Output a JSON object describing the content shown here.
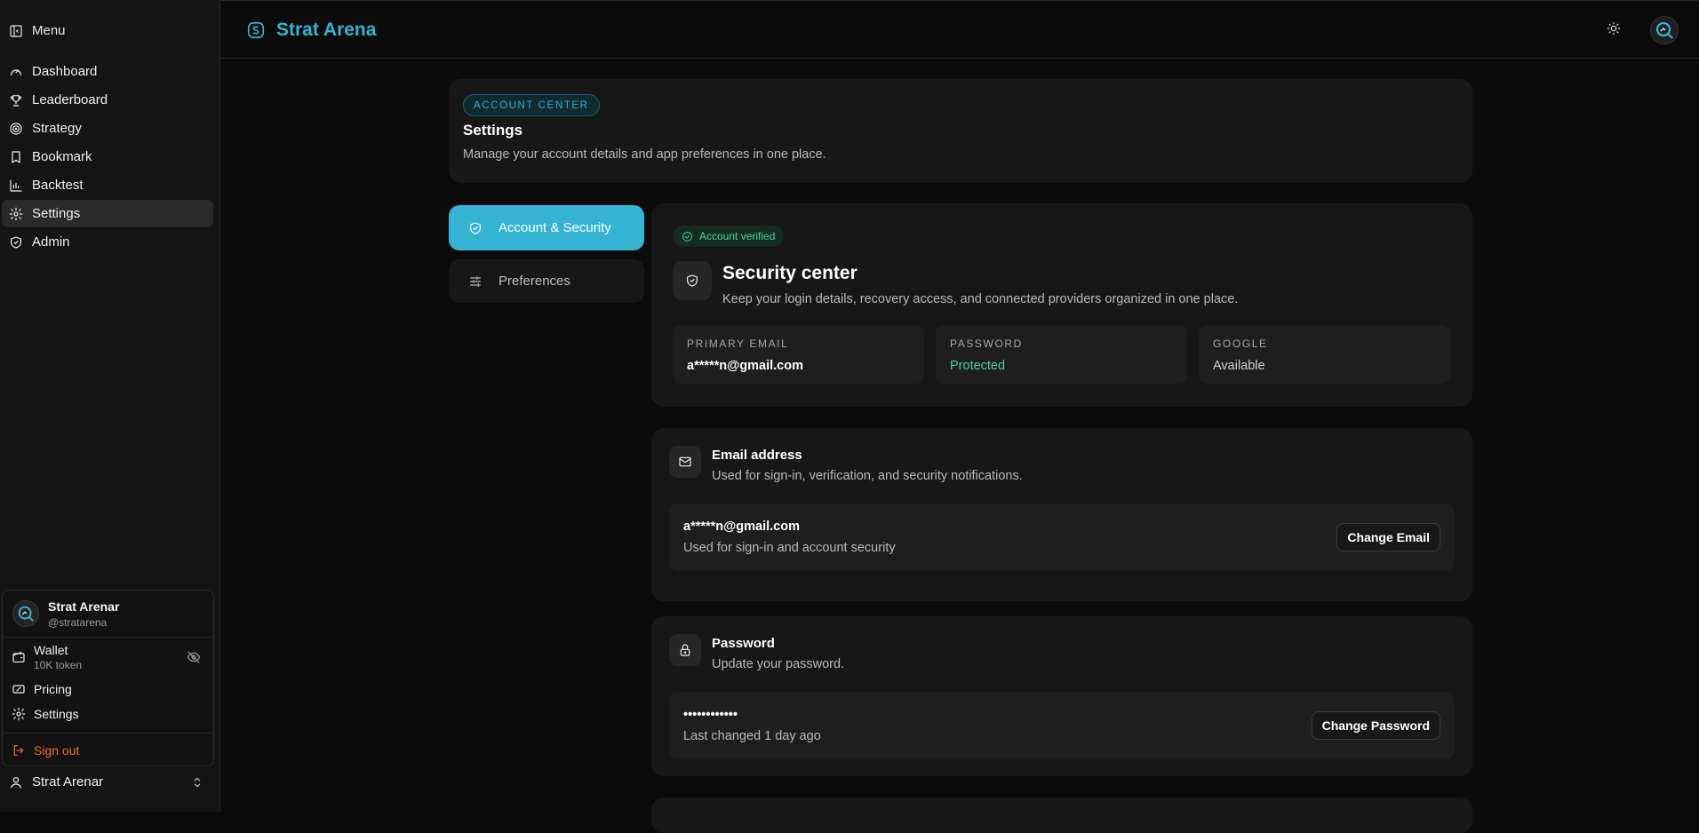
{
  "sidebar": {
    "menu_label": "Menu",
    "items": [
      {
        "label": "Dashboard",
        "icon": "gauge-icon"
      },
      {
        "label": "Leaderboard",
        "icon": "trophy-icon"
      },
      {
        "label": "Strategy",
        "icon": "target-icon"
      },
      {
        "label": "Bookmark",
        "icon": "bookmark-icon"
      },
      {
        "label": "Backtest",
        "icon": "chart-icon"
      },
      {
        "label": "Settings",
        "icon": "gear-icon",
        "active": true
      },
      {
        "label": "Admin",
        "icon": "shield-icon"
      }
    ],
    "user_card": {
      "name": "Strat Arenar",
      "handle": "@stratarena",
      "wallet_label": "Wallet",
      "wallet_sub": "10K token",
      "pricing_label": "Pricing",
      "settings_label": "Settings",
      "signout_label": "Sign out"
    },
    "footer_user": "Strat Arenar"
  },
  "topbar": {
    "brand": "Strat Arena"
  },
  "account_header": {
    "badge": "ACCOUNT CENTER",
    "title": "Settings",
    "description": "Manage your account details and app preferences in one place."
  },
  "tabs": [
    {
      "label": "Account & Security",
      "active": true
    },
    {
      "label": "Preferences",
      "active": false
    }
  ],
  "security": {
    "verified_label": "Account verified",
    "title": "Security center",
    "description": "Keep your login details, recovery access, and connected providers organized in one place.",
    "stats": [
      {
        "label": "PRIMARY EMAIL",
        "value": "a*****n@gmail.com"
      },
      {
        "label": "PASSWORD",
        "value": "Protected"
      },
      {
        "label": "GOOGLE",
        "value": "Available"
      }
    ]
  },
  "email_section": {
    "title": "Email address",
    "description": "Used for sign-in, verification, and security notifications.",
    "value": "a*****n@gmail.com",
    "value_sub": "Used for sign-in and account security",
    "button": "Change Email"
  },
  "password_section": {
    "title": "Password",
    "description": "Update your password.",
    "value": "••••••••••••",
    "value_sub": "Last changed 1 day ago",
    "button": "Change Password"
  },
  "colors": {
    "accent": "#34b4d2",
    "success": "#4fd1a1",
    "danger": "#f06a32"
  }
}
